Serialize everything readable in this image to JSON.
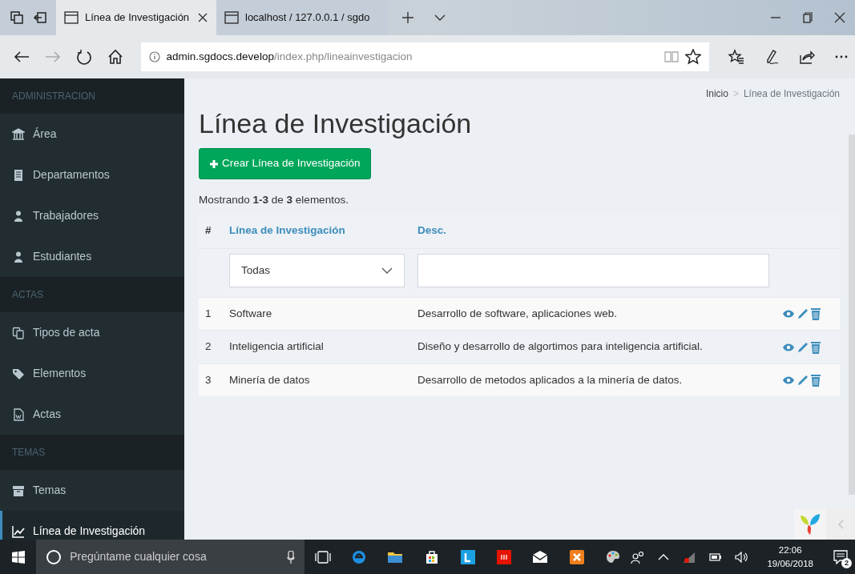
{
  "browser": {
    "tabs": [
      {
        "title": "Línea de Investigación",
        "selected": true
      },
      {
        "title": "localhost / 127.0.0.1 / sgdo",
        "selected": false
      }
    ],
    "address": {
      "host": "admin.sgdocs.develop",
      "path": "/index.php/lineainvestigacion"
    }
  },
  "sidebar": {
    "sections": [
      {
        "header": "ADMINISTRACION",
        "items": [
          {
            "label": "Área",
            "selected": false
          },
          {
            "label": "Departamentos",
            "selected": false
          },
          {
            "label": "Trabajadores",
            "selected": false
          },
          {
            "label": "Estudiantes",
            "selected": false
          }
        ]
      },
      {
        "header": "ACTAS",
        "items": [
          {
            "label": "Tipos de acta",
            "selected": false
          },
          {
            "label": "Elementos",
            "selected": false
          },
          {
            "label": "Actas",
            "selected": false
          }
        ]
      },
      {
        "header": "TEMAS",
        "items": [
          {
            "label": "Temas",
            "selected": false
          },
          {
            "label": "Línea de Investigación",
            "selected": true
          }
        ]
      }
    ]
  },
  "breadcrumb": [
    "Inicio",
    "Línea de Investigación"
  ],
  "breadcrumb_separator": ">",
  "title": "Línea de Investigación",
  "create_button": "Crear Línea de Investigación",
  "summary": "Mostrando **1-3** de **3** elementos.",
  "table": {
    "columns": [
      "#",
      "Línea de Investigación",
      "Desc."
    ],
    "filters": {
      "select": "Todas"
    },
    "rows": [
      {
        "num": "1",
        "name": "Software",
        "desc": "Desarrollo de software, aplicaciones web."
      },
      {
        "num": "2",
        "name": "Inteligencia artificial",
        "desc": "Diseño y desarrollo de algortimos para inteligencia artificial."
      },
      {
        "num": "3",
        "name": "Minería de datos",
        "desc": "Desarrollo de metodos aplicados a la minería de datos."
      }
    ]
  },
  "taskbar": {
    "search_placeholder": "Pregúntame cualquier cosa",
    "time": "22:06",
    "date": "19/06/2018",
    "notifications": "2"
  }
}
